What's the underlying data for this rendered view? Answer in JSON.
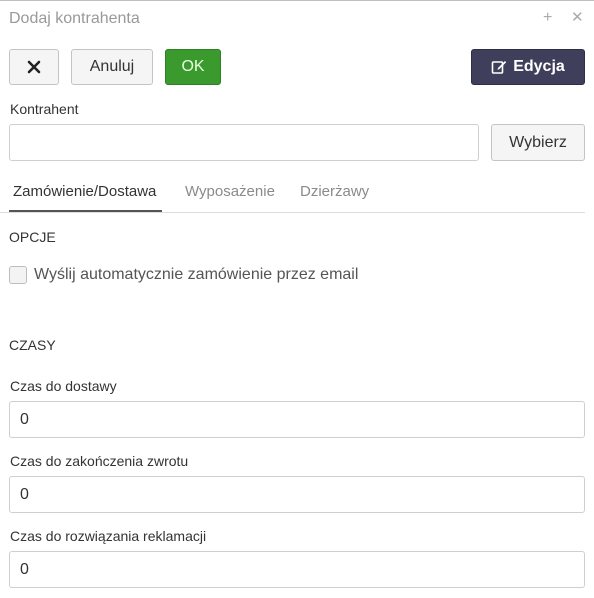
{
  "window": {
    "title": "Dodaj kontrahenta",
    "plus": "+",
    "close": "✕"
  },
  "toolbar": {
    "close_label": "✕",
    "cancel_label": "Anuluj",
    "ok_label": "OK",
    "edit_label": "Edycja",
    "edit_icon": "edit-icon"
  },
  "kontrahent": {
    "label": "Kontrahent",
    "value": "",
    "choose_label": "Wybierz"
  },
  "tabs": [
    {
      "label": "Zamówienie/Dostawa",
      "active": true
    },
    {
      "label": "Wyposażenie",
      "active": false
    },
    {
      "label": "Dzierżawy",
      "active": false
    }
  ],
  "opcje": {
    "heading": "OPCJE",
    "auto_email": {
      "label": "Wyślij automatycznie zamówienie przez email",
      "checked": false
    }
  },
  "czasy": {
    "heading": "CZASY",
    "fields": [
      {
        "label": "Czas do dostawy",
        "value": "0"
      },
      {
        "label": "Czas do zakończenia zwrotu",
        "value": "0"
      },
      {
        "label": "Czas do rozwiązania reklamacji",
        "value": "0"
      }
    ]
  },
  "colors": {
    "ok": "#3a9a2e",
    "edit": "#3f3f5c"
  }
}
